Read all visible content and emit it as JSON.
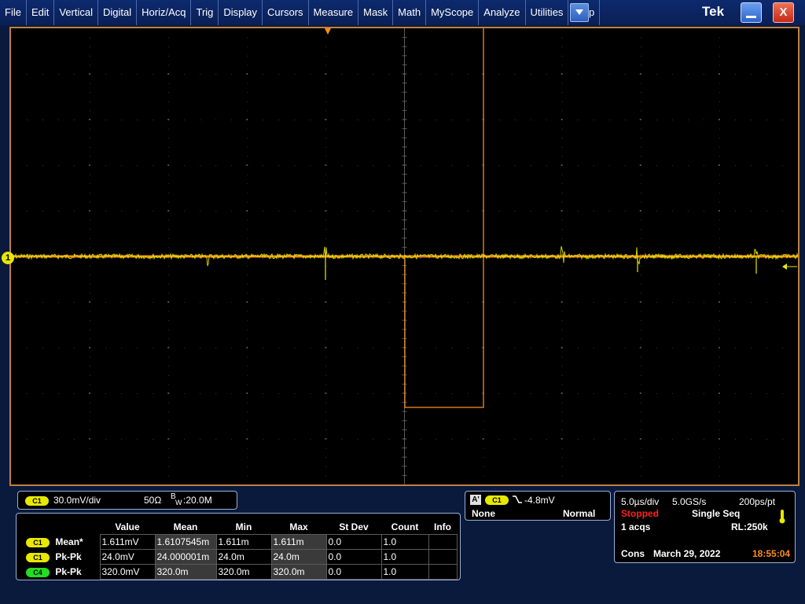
{
  "menubar": {
    "items": [
      "File",
      "Edit",
      "Vertical",
      "Digital",
      "Horiz/Acq",
      "Trig",
      "Display",
      "Cursors",
      "Measure",
      "Mask",
      "Math",
      "MyScope",
      "Analyze",
      "Utilities",
      "Help"
    ],
    "logo": "Tek",
    "close_label": "X"
  },
  "channel_marker": "1",
  "channel_setup": {
    "badge": "C1",
    "scale": "30.0mV/div",
    "impedance": "50Ω",
    "bandwidth_prefix": "B",
    "bandwidth_sub": "W",
    "bandwidth": ":20.0M"
  },
  "measurements": {
    "headers": [
      "Value",
      "Mean",
      "Min",
      "Max",
      "St Dev",
      "Count",
      "Info"
    ],
    "rows": [
      {
        "badge": "C1",
        "badge_color": "#e8e800",
        "name": "Mean*",
        "value": "1.611mV",
        "mean": "1.6107545m",
        "min": "1.611m",
        "max": "1.611m",
        "stdev": "0.0",
        "count": "1.0",
        "info": ""
      },
      {
        "badge": "C1",
        "badge_color": "#e8e800",
        "name": "Pk-Pk",
        "value": "24.0mV",
        "mean": "24.000001m",
        "min": "24.0m",
        "max": "24.0m",
        "stdev": "0.0",
        "count": "1.0",
        "info": ""
      },
      {
        "badge": "C4",
        "badge_color": "#22dd22",
        "name": "Pk-Pk",
        "value": "320.0mV",
        "mean": "320.0m",
        "min": "320.0m",
        "max": "320.0m",
        "stdev": "0.0",
        "count": "1.0",
        "info": ""
      }
    ]
  },
  "trigger": {
    "a_label": "A'",
    "badge": "C1",
    "level": "-4.8mV",
    "coupling": "None",
    "mode": "Normal"
  },
  "acquisition": {
    "timebase": "5.0µs/div",
    "sample_rate": "5.0GS/s",
    "resolution": "200ps/pt",
    "state": "Stopped",
    "mode": "Single Seq",
    "acqs": "1 acqs",
    "record_length": "RL:250k",
    "cons": "Cons",
    "date": "March 29, 2022",
    "time": "18:55:04"
  },
  "colors": {
    "trace_c1": "#e8e800",
    "trace_c4": "#ff8c1a",
    "state_stopped": "#ff2020",
    "time": "#ff8c1a",
    "frame": "#c08040"
  }
}
